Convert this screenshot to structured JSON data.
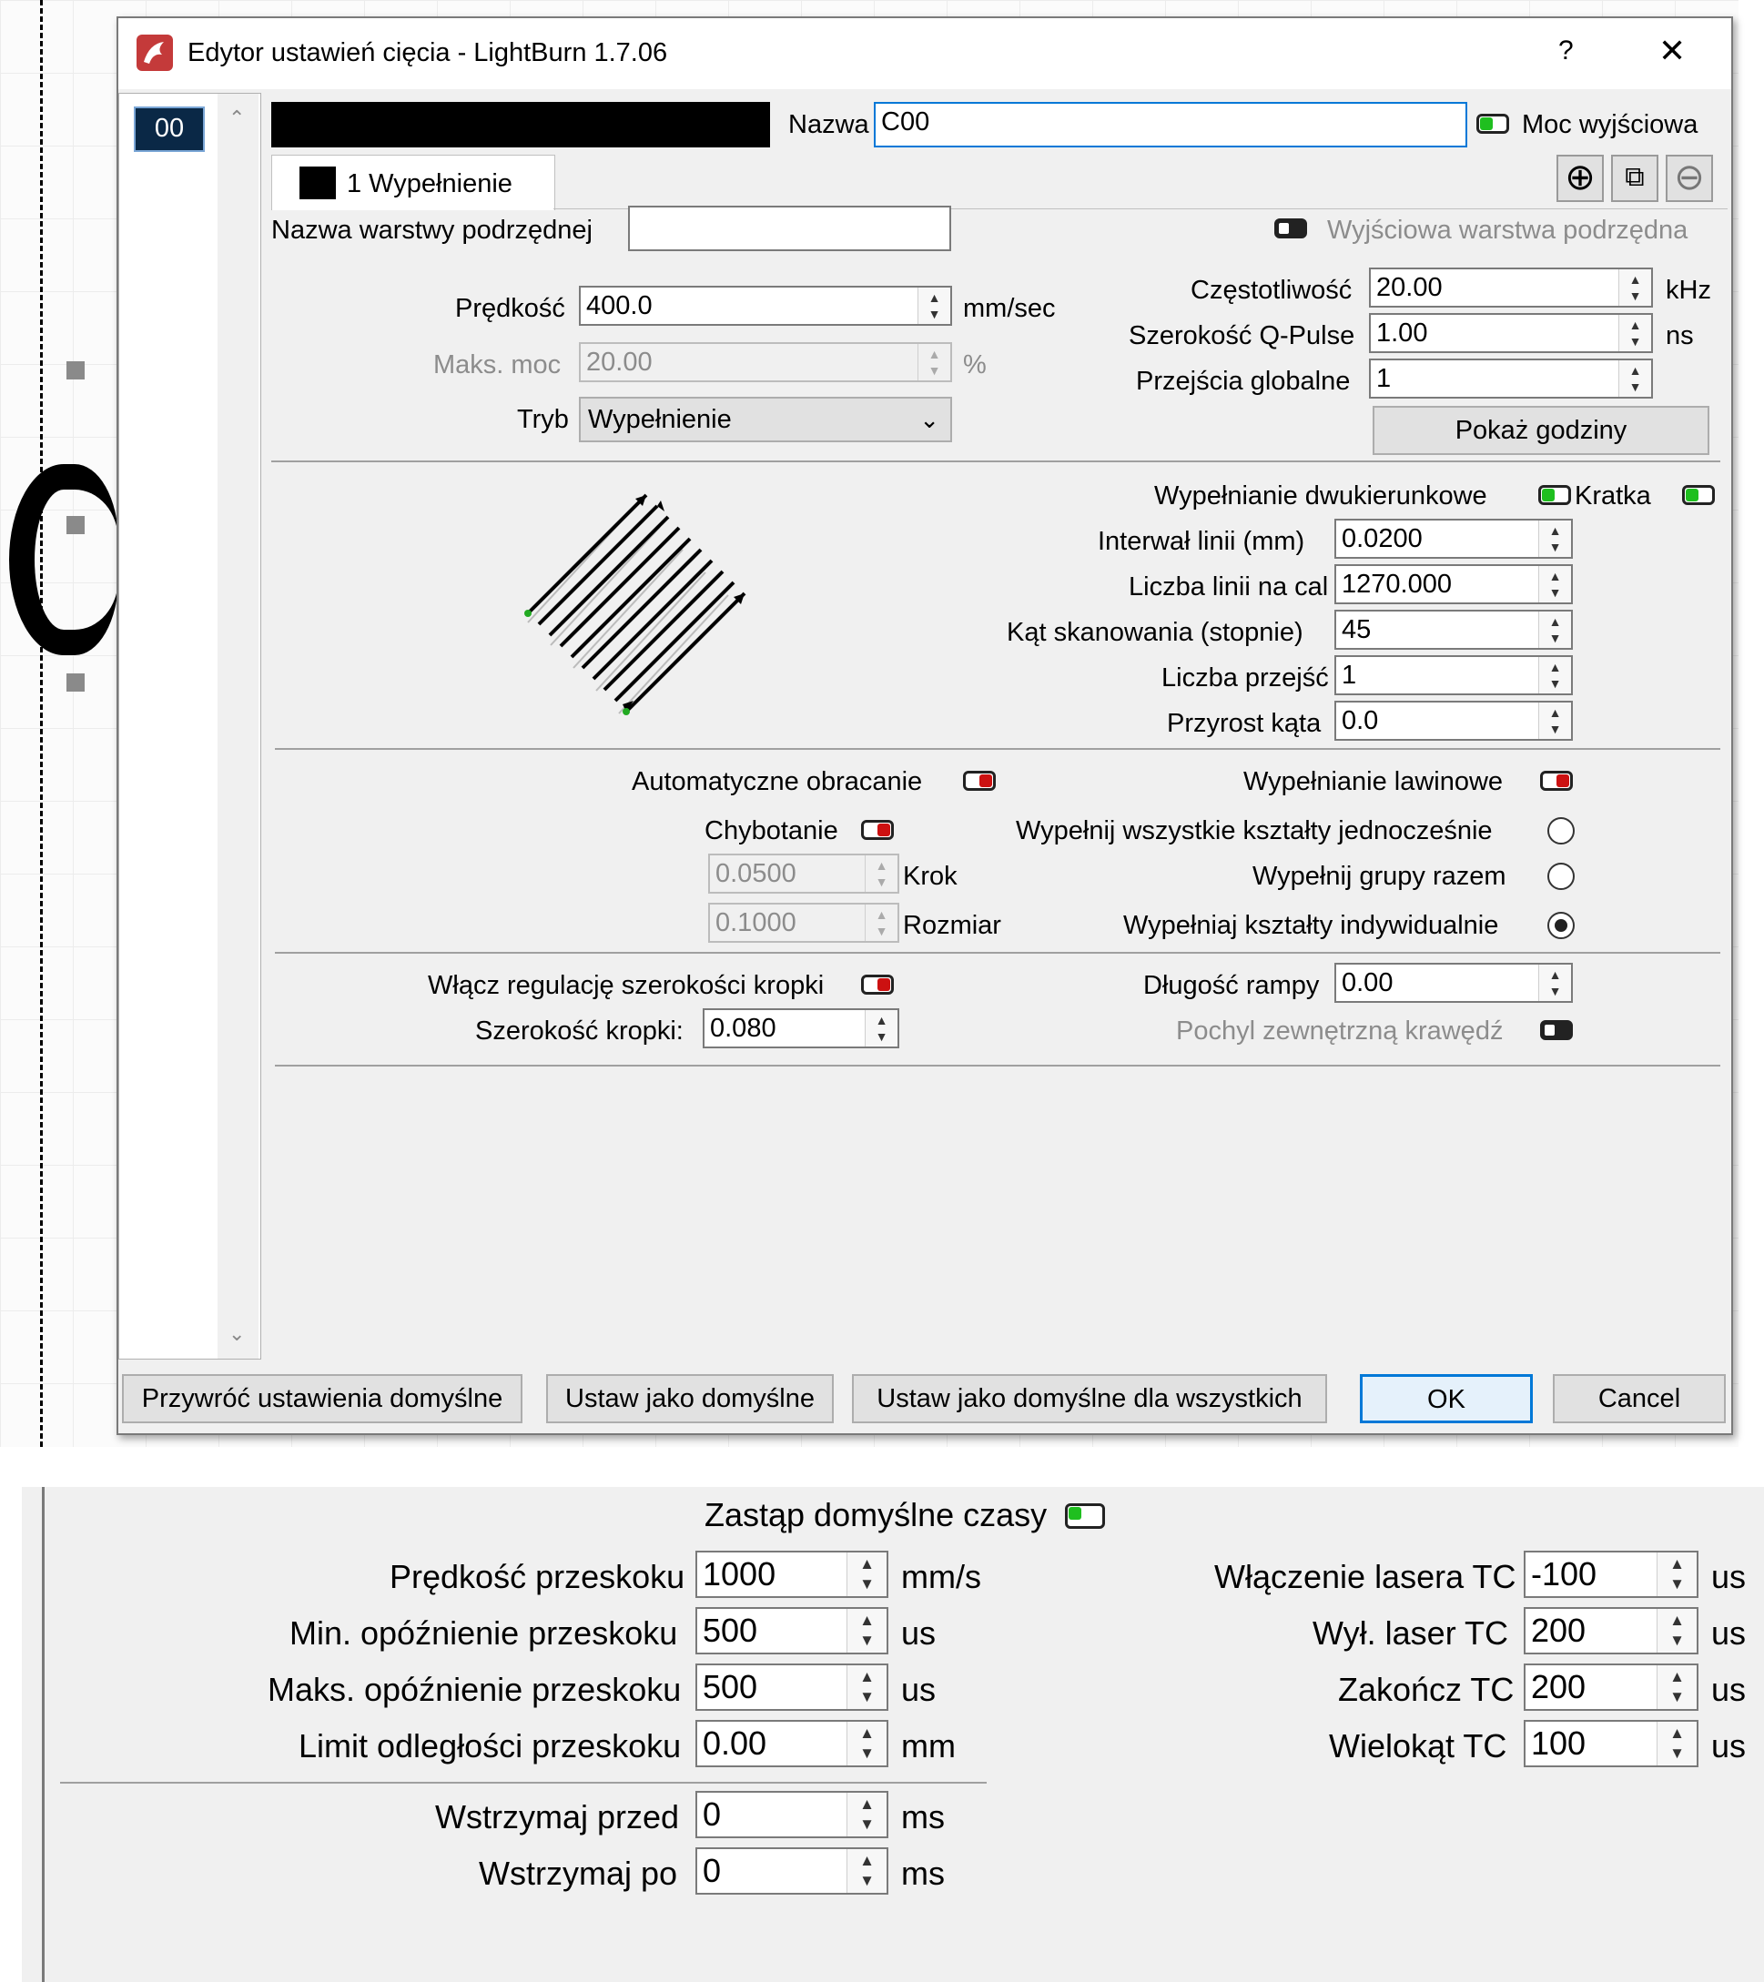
{
  "dialog": {
    "title": "Edytor ustawień cięcia - LightBurn 1.7.06",
    "help_label": "?",
    "close_label": "✕"
  },
  "layer_list": {
    "items": [
      "00"
    ]
  },
  "header": {
    "name_label": "Nazwa",
    "name_value": "C00",
    "output_label": "Moc wyjściowa",
    "tab_label": "1 Wypełnienie",
    "sublayer_name_label": "Nazwa warstwy podrzędnej",
    "sublayer_name_value": "",
    "sublayer_output_label": "Wyjściowa warstwa podrzędna"
  },
  "main": {
    "speed_label": "Prędkość",
    "speed_value": "400.0",
    "speed_unit": "mm/sec",
    "maxpower_label": "Maks. moc",
    "maxpower_value": "20.00",
    "maxpower_unit": "%",
    "mode_label": "Tryb",
    "mode_value": "Wypełnienie",
    "freq_label": "Częstotliwość",
    "freq_value": "20.00",
    "freq_unit": "kHz",
    "qpulse_label": "Szerokość Q-Pulse",
    "qpulse_value": "1.00",
    "qpulse_unit": "ns",
    "passes_label": "Przejścia globalne",
    "passes_value": "1",
    "hours_button": "Pokaż godziny"
  },
  "fill": {
    "bidir_label": "Wypełnianie dwukierunkowe",
    "crosshatch_label": "Kratka",
    "interval_label": "Interwał linii (mm)",
    "interval_value": "0.0200",
    "lpi_label": "Liczba linii na cal",
    "lpi_value": "1270.000",
    "angle_label": "Kąt skanowania (stopnie)",
    "angle_value": "45",
    "numpasses_label": "Liczba przejść",
    "numpasses_value": "1",
    "angleinc_label": "Przyrost kąta",
    "angleinc_value": "0.0"
  },
  "options": {
    "autorotate_label": "Automatyczne obracanie",
    "flood_label": "Wypełnianie lawinowe",
    "wobble_label": "Chybotanie",
    "fill_all_label": "Wypełnij wszystkie kształty jednocześnie",
    "step_value": "0.0500",
    "step_label": "Krok",
    "fill_groups_label": "Wypełnij grupy razem",
    "size_value": "0.1000",
    "size_label": "Rozmiar",
    "fill_indiv_label": "Wypełniaj kształty indywidualnie"
  },
  "dot": {
    "dotwidth_enable_label": "Włącz regulację szerokości kropki",
    "ramp_label": "Długość rampy",
    "ramp_value": "0.00",
    "dotwidth_label": "Szerokość kropki:",
    "dotwidth_value": "0.080",
    "bevel_label": "Pochyl zewnętrzną krawędź"
  },
  "footer": {
    "restore": "Przywróć ustawienia domyślne",
    "setdefault": "Ustaw jako domyślne",
    "setdefault_all": "Ustaw jako domyślne dla wszystkich",
    "ok": "OK",
    "cancel": "Cancel"
  },
  "timing": {
    "override_label": "Zastąp domyślne czasy",
    "jump_speed_label": "Prędkość przeskoku",
    "jump_speed_value": "1000",
    "jump_speed_unit": "mm/s",
    "min_jump_label": "Min. opóźnienie przeskoku",
    "min_jump_value": "500",
    "min_jump_unit": "us",
    "max_jump_label": "Maks. opóźnienie przeskoku",
    "max_jump_value": "500",
    "max_jump_unit": "us",
    "jump_limit_label": "Limit odległości przeskoku",
    "jump_limit_value": "0.00",
    "jump_limit_unit": "mm",
    "dwell_before_label": "Wstrzymaj przed",
    "dwell_before_value": "0",
    "dwell_before_unit": "ms",
    "dwell_after_label": "Wstrzymaj po",
    "dwell_after_value": "0",
    "dwell_after_unit": "ms",
    "laser_on_label": "Włączenie lasera TC",
    "laser_on_value": "-100",
    "laser_on_unit": "us",
    "laser_off_label": "Wył. laser TC",
    "laser_off_value": "200",
    "laser_off_unit": "us",
    "end_label": "Zakończ TC",
    "end_value": "200",
    "end_unit": "us",
    "polygon_label": "Wielokąt TC",
    "polygon_value": "100",
    "polygon_unit": "us"
  },
  "colors": {
    "accent": "#0078d7",
    "toggle_on": "#1fbf1f",
    "toggle_off": "#cc1111"
  }
}
